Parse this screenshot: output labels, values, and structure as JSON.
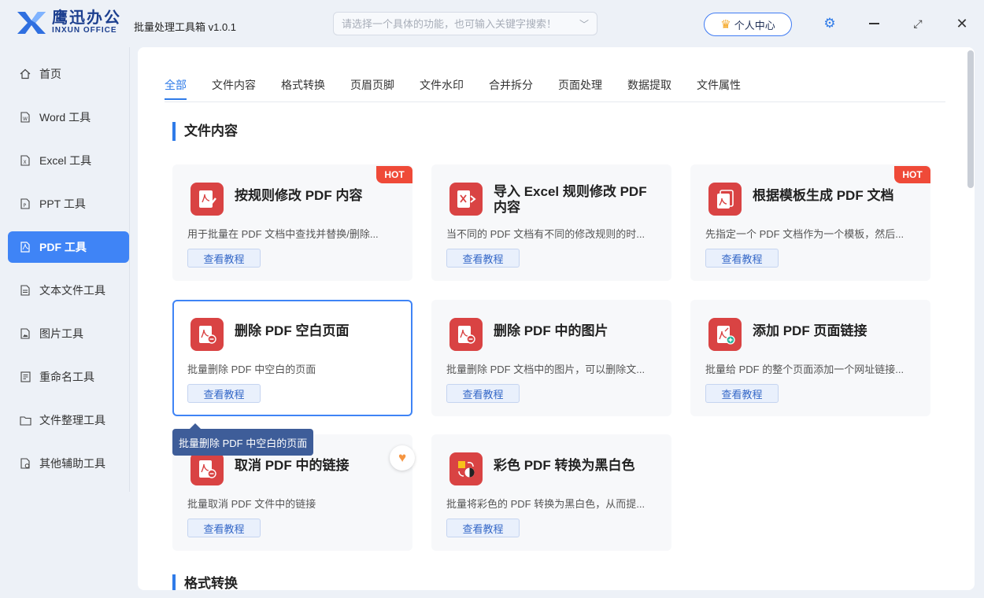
{
  "app": {
    "logo_cn": "鹰迅办公",
    "logo_en": "INXUN OFFICE",
    "title": "批量处理工具箱 v1.0.1",
    "search_placeholder": "请选择一个具体的功能，也可输入关键字搜索！",
    "user_center": "个人中心"
  },
  "colors": {
    "accent": "#2f7be8",
    "active_nav": "#3f84f6",
    "pdf_red": "#d94343",
    "hot": "#ef4a38"
  },
  "sidebar": {
    "items": [
      {
        "label": "首页",
        "icon": "home-icon"
      },
      {
        "label": "Word 工具",
        "icon": "word-file-icon"
      },
      {
        "label": "Excel 工具",
        "icon": "excel-file-icon"
      },
      {
        "label": "PPT 工具",
        "icon": "ppt-file-icon"
      },
      {
        "label": "PDF 工具",
        "icon": "pdf-file-icon",
        "active": true
      },
      {
        "label": "文本文件工具",
        "icon": "text-file-icon"
      },
      {
        "label": "图片工具",
        "icon": "image-file-icon"
      },
      {
        "label": "重命名工具",
        "icon": "rename-icon"
      },
      {
        "label": "文件整理工具",
        "icon": "folder-icon"
      },
      {
        "label": "其他辅助工具",
        "icon": "tools-icon"
      }
    ]
  },
  "tabs": [
    {
      "label": "全部",
      "active": true
    },
    {
      "label": "文件内容"
    },
    {
      "label": "格式转换"
    },
    {
      "label": "页眉页脚"
    },
    {
      "label": "文件水印"
    },
    {
      "label": "合并拆分"
    },
    {
      "label": "页面处理"
    },
    {
      "label": "数据提取"
    },
    {
      "label": "文件属性"
    }
  ],
  "sections": [
    {
      "title": "文件内容"
    },
    {
      "title": "格式转换"
    }
  ],
  "tutorial_label": "查看教程",
  "hot_label": "HOT",
  "cards": [
    {
      "title": "按规则修改 PDF 内容",
      "desc": "用于批量在 PDF 文档中查找并替换/删除...",
      "hot": true,
      "icon": "pdf-edit-icon"
    },
    {
      "title": "导入 Excel 规则修改 PDF 内容",
      "desc": "当不同的 PDF 文档有不同的修改规则的时...",
      "hot": false,
      "icon": "excel-import-icon"
    },
    {
      "title": "根据模板生成 PDF 文档",
      "desc": "先指定一个 PDF 文档作为一个模板，然后...",
      "hot": true,
      "icon": "pdf-template-icon"
    },
    {
      "title": "删除 PDF 空白页面",
      "desc": "批量删除 PDF 中空白的页面",
      "hot": false,
      "selected": true,
      "icon": "pdf-delete-page-icon"
    },
    {
      "title": "删除 PDF 中的图片",
      "desc": "批量删除 PDF 文档中的图片，可以删除文...",
      "hot": false,
      "icon": "pdf-delete-image-icon"
    },
    {
      "title": "添加 PDF 页面链接",
      "desc": "批量给 PDF 的整个页面添加一个网址链接...",
      "hot": false,
      "icon": "pdf-add-link-icon"
    },
    {
      "title": "取消 PDF 中的链接",
      "desc": "批量取消 PDF 文件中的链接",
      "hot": false,
      "icon": "pdf-remove-link-icon"
    },
    {
      "title": "彩色 PDF 转换为黑白色",
      "desc": "批量将彩色的 PDF 转换为黑白色，从而提...",
      "hot": false,
      "icon": "color-to-bw-icon"
    }
  ],
  "tooltip": "批量删除 PDF 中空白的页面"
}
